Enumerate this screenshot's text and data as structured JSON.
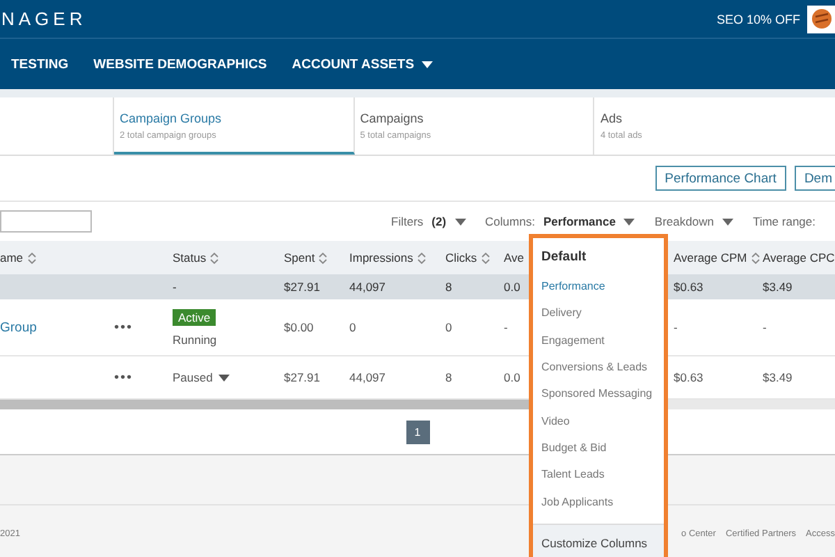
{
  "header": {
    "brand": "NAGER",
    "promo": "SEO 10% OFF"
  },
  "nav": [
    {
      "label": "TESTING",
      "caret": false
    },
    {
      "label": "WEBSITE DEMOGRAPHICS",
      "caret": false
    },
    {
      "label": "ACCOUNT ASSETS",
      "caret": true
    }
  ],
  "tabs": [
    {
      "title": "Campaign Groups",
      "subtitle": "2 total campaign groups",
      "selected": true
    },
    {
      "title": "Campaigns",
      "subtitle": "5 total campaigns",
      "selected": false
    },
    {
      "title": "Ads",
      "subtitle": "4 total ads",
      "selected": false
    }
  ],
  "actions": [
    "Performance Chart",
    "Dem"
  ],
  "toolbar": {
    "filters": "Filters **(2)**",
    "columns": "Columns: **Performance**",
    "breakdown": "Breakdown",
    "time_range": "Time range:"
  },
  "table": {
    "columns": [
      {
        "label": "ame",
        "sortable": true
      },
      {
        "label": "Status",
        "sortable": true
      },
      {
        "label": "Spent",
        "sortable": true
      },
      {
        "label": "Impressions",
        "sortable": true
      },
      {
        "label": "Clicks",
        "sortable": true
      },
      {
        "label": "Ave",
        "sortable": false
      },
      {
        "label": "Average CPM",
        "sortable": true
      },
      {
        "label": "Average CPC",
        "sortable": false
      }
    ],
    "rows": [
      {
        "kind": "total",
        "status": "-",
        "spent": "$27.91",
        "impressions": "44,097",
        "clicks": "8",
        "ave": "0.0",
        "cpm": "$0.63",
        "cpc": "$3.49"
      },
      {
        "kind": "item",
        "name": "Group",
        "menu": "•••",
        "badge": "Active",
        "status": "Running",
        "status_caret": false,
        "spent": "$0.00",
        "impressions": "0",
        "clicks": "0",
        "ave": "-",
        "cpm": "-",
        "cpc": "-"
      },
      {
        "kind": "item",
        "menu": "•••",
        "status": "Paused",
        "status_caret": true,
        "spent": "$27.91",
        "impressions": "44,097",
        "clicks": "8",
        "ave": "0.0",
        "cpm": "$0.63",
        "cpc": "$3.49"
      }
    ]
  },
  "pagination": [
    {
      "label": "1",
      "selected": true
    }
  ],
  "footer": {
    "copyright": "2021",
    "links": [
      "o Center",
      "Certified Partners",
      "Access"
    ]
  },
  "columns_menu": {
    "heading": "Default",
    "items": [
      {
        "label": "Performance",
        "selected": true
      },
      {
        "label": "Delivery",
        "selected": false
      },
      {
        "label": "Engagement",
        "selected": false
      },
      {
        "label": "Conversions & Leads",
        "selected": false
      },
      {
        "label": "Sponsored Messaging",
        "selected": false
      },
      {
        "label": "Video",
        "selected": false
      },
      {
        "label": "Budget & Bid",
        "selected": false
      },
      {
        "label": "Talent Leads",
        "selected": false
      },
      {
        "label": "Job Applicants",
        "selected": false
      }
    ],
    "footer": "Customize Columns"
  }
}
